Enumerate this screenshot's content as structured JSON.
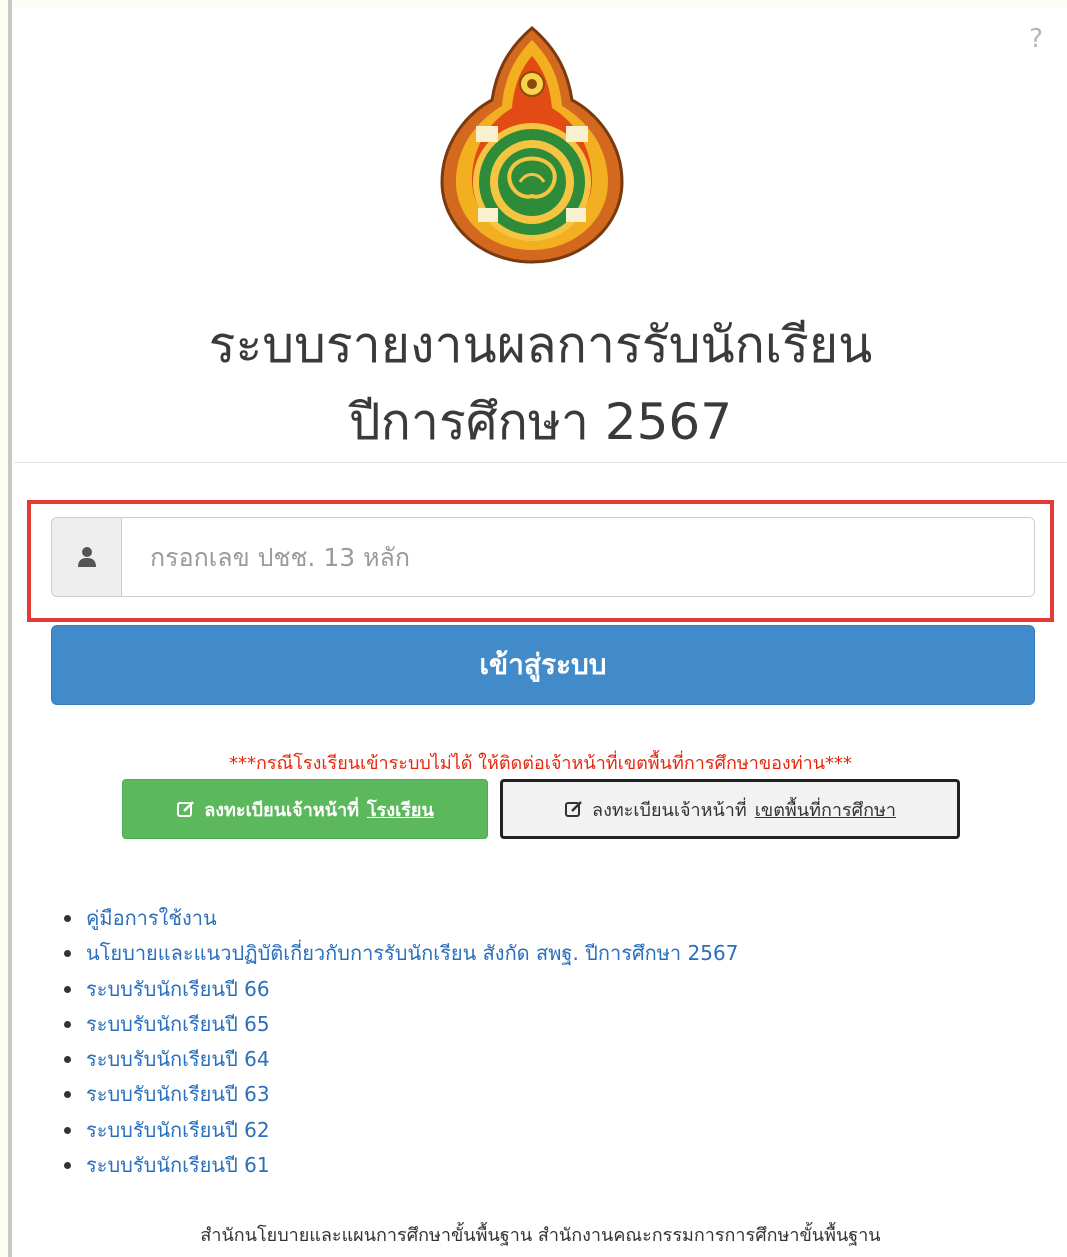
{
  "help": {
    "label": "?"
  },
  "header": {
    "logo_icon": "obec-seal-logo",
    "title_line1": "ระบบรายงานผลการรับนักเรียน",
    "title_line2": "ปีการศึกษา 2567"
  },
  "login": {
    "user_icon": "user-icon",
    "id_placeholder": "กรอกเลข ปชช. 13 หลัก",
    "id_value": "",
    "submit_label": "เข้าสู่ระบบ"
  },
  "notice": "***กรณีโรงเรียนเข้าระบบไม่ได้ ให้ติดต่อเจ้าหน้าที่เขตพื้นที่การศึกษาของท่าน***",
  "register": {
    "icon": "edit-icon",
    "school_prefix": "ลงทะเบียนเจ้าหน้าที่",
    "school_link": "โรงเรียน",
    "area_prefix": "ลงทะเบียนเจ้าหน้าที่",
    "area_link": "เขตพื้นที่การศึกษา"
  },
  "links": [
    "คู่มือการใช้งาน",
    "นโยบายและแนวปฏิบัติเกี่ยวกับการรับนักเรียน สังกัด สพฐ. ปีการศึกษา 2567",
    "ระบบรับนักเรียนปี 66",
    "ระบบรับนักเรียนปี 65",
    "ระบบรับนักเรียนปี 64",
    "ระบบรับนักเรียนปี 63",
    "ระบบรับนักเรียนปี 62",
    "ระบบรับนักเรียนปี 61"
  ],
  "footer": "สำนักนโยบายและแผนการศึกษาขั้นพื้นฐาน สำนักงานคณะกรรมการการศึกษาขั้นพื้นฐาน",
  "colors": {
    "primary": "#428bca",
    "success": "#5cb85c",
    "danger": "#e8270c",
    "link": "#2a6fbd",
    "highlight": "#e53935"
  }
}
